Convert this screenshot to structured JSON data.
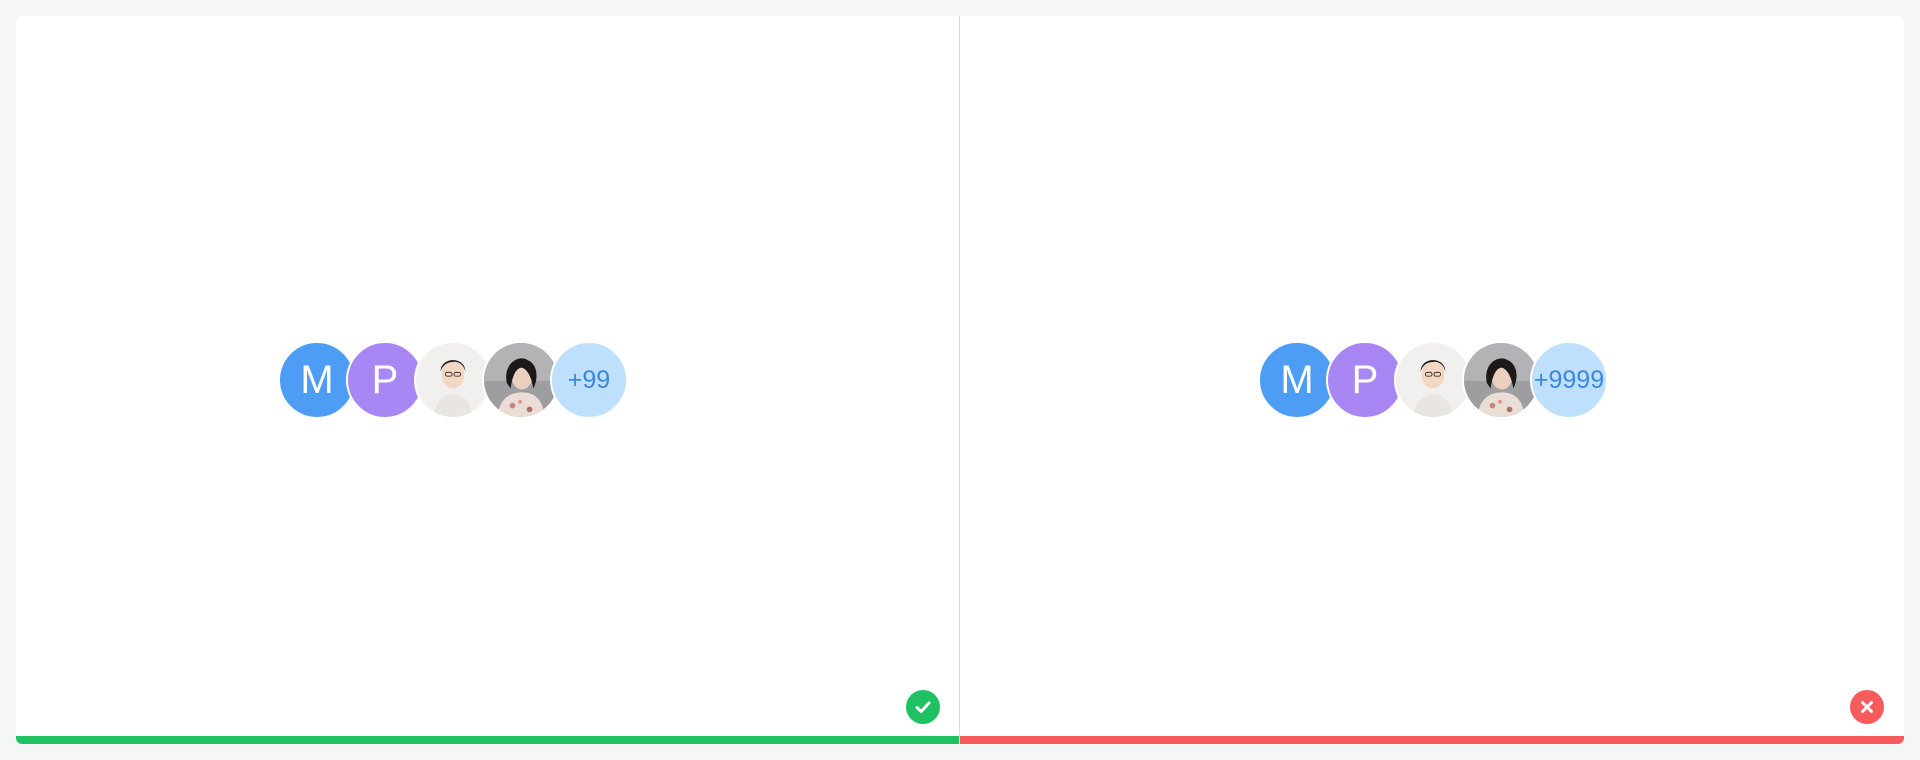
{
  "left_example": {
    "avatars": [
      {
        "type": "letter",
        "text": "M",
        "color": "#4e9df5"
      },
      {
        "type": "letter",
        "text": "P",
        "color": "#a886f4"
      },
      {
        "type": "photo",
        "icon": "user-photo-icon"
      },
      {
        "type": "photo",
        "icon": "user-photo-icon"
      }
    ],
    "overflow_count": "+99",
    "status": "correct",
    "status_icon": "check-circle-icon",
    "status_color": "#1fc162"
  },
  "right_example": {
    "avatars": [
      {
        "type": "letter",
        "text": "M",
        "color": "#4e9df5"
      },
      {
        "type": "letter",
        "text": "P",
        "color": "#a886f4"
      },
      {
        "type": "photo",
        "icon": "user-photo-icon"
      },
      {
        "type": "photo",
        "icon": "user-photo-icon"
      }
    ],
    "overflow_count": "+9999",
    "status": "incorrect",
    "status_icon": "close-circle-icon",
    "status_color": "#f75b5b"
  }
}
